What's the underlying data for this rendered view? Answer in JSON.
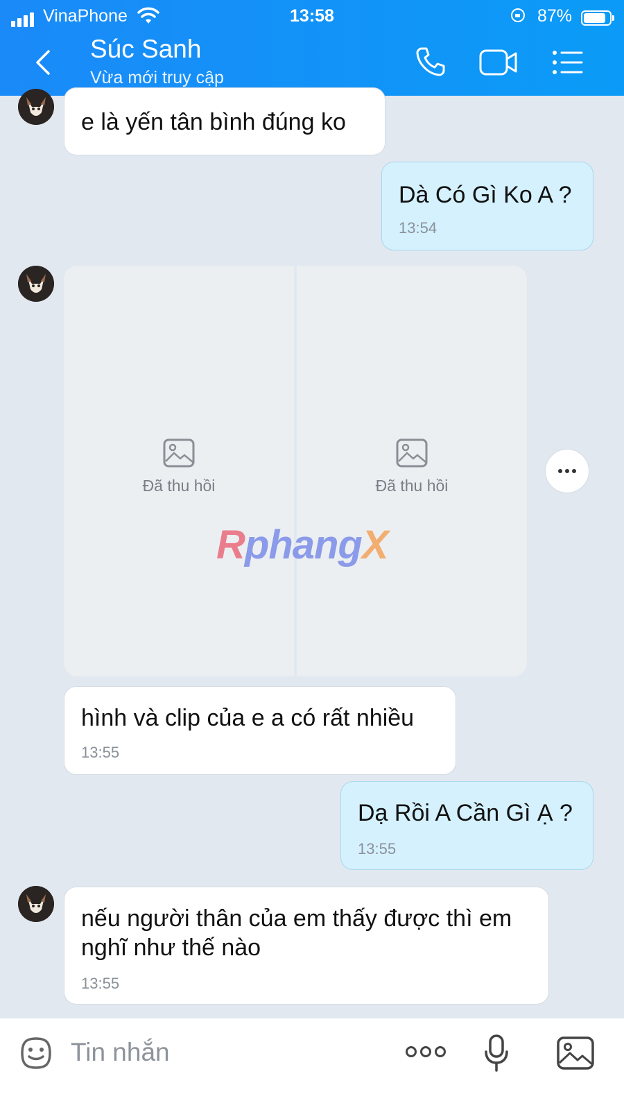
{
  "status_bar": {
    "carrier": "VinaPhone",
    "time": "13:58",
    "battery_percent": "87%",
    "battery_level": 0.87
  },
  "header": {
    "contact_name": "Súc Sanh",
    "presence": "Vừa mới truy cập",
    "icons": [
      "back-icon",
      "phone-icon",
      "video-call-icon",
      "menu-list-icon"
    ]
  },
  "messages": [
    {
      "direction": "incoming",
      "text": "e là yến tân bình đúng ko",
      "time": ""
    },
    {
      "direction": "outgoing",
      "text": "Dà Có Gì Ko A ?",
      "time": "13:54"
    },
    {
      "direction": "incoming",
      "type": "media",
      "items": [
        {
          "label": "Đã thu hồi",
          "icon": "image-icon"
        },
        {
          "label": "Đã thu hồi",
          "icon": "image-icon"
        }
      ]
    },
    {
      "direction": "incoming",
      "text": "hình và clip của e a có rất nhiều",
      "time": "13:55"
    },
    {
      "direction": "outgoing",
      "text": "Dạ Rồi A Cần Gì Ạ ?",
      "time": "13:55"
    },
    {
      "direction": "incoming",
      "text_line1": "nếu người thân của em thấy được thì em",
      "text_line2": "nghĩ như thế nào",
      "time": "13:55"
    }
  ],
  "watermark": {
    "part1": "R",
    "part2": "phang",
    "part3": "X"
  },
  "input_bar": {
    "placeholder": "Tin nhắn",
    "icons": [
      "sticker-icon",
      "more-options-icon",
      "microphone-icon",
      "gallery-icon"
    ]
  },
  "colors": {
    "header": "#1a8af8",
    "background": "#e2e8f0",
    "outgoing_bubble": "#d4f1fd",
    "incoming_bubble": "#ffffff"
  }
}
